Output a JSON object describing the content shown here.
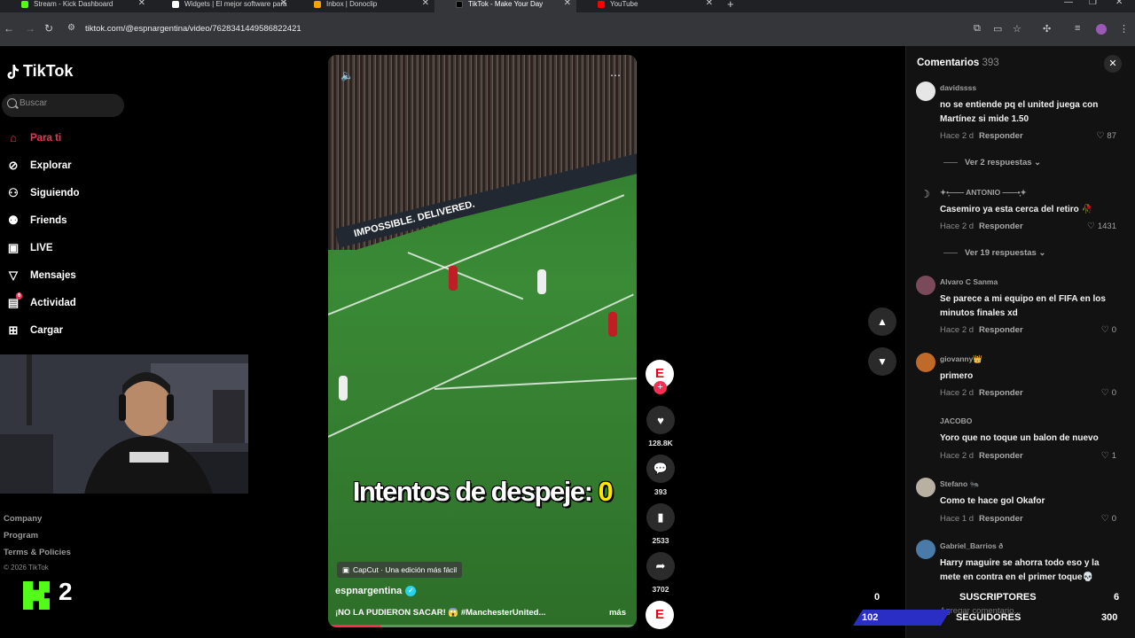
{
  "browser": {
    "tabs": [
      {
        "title": "Stream - Kick Dashboard",
        "color": "#53fc18",
        "active": false
      },
      {
        "title": "Widgets | El mejor software para",
        "color": "#ffffff",
        "active": false
      },
      {
        "title": "Inbox | Donoclip",
        "color": "#f4a300",
        "active": false
      },
      {
        "title": "TikTok - Make Your Day",
        "color": "#000000",
        "active": true
      },
      {
        "title": "YouTube",
        "color": "#ff0000",
        "active": false
      }
    ],
    "url": "tiktok.com/@espnargentina/video/7628341449586822421"
  },
  "sidebar": {
    "brand": "TikTok",
    "search_placeholder": "Buscar",
    "items": [
      {
        "label": "Para ti",
        "icon": "home-icon",
        "active": true
      },
      {
        "label": "Explorar",
        "icon": "compass-icon"
      },
      {
        "label": "Siguiendo",
        "icon": "following-icon"
      },
      {
        "label": "Friends",
        "icon": "friends-icon"
      },
      {
        "label": "LIVE",
        "icon": "live-icon"
      },
      {
        "label": "Mensajes",
        "icon": "messages-icon"
      },
      {
        "label": "Actividad",
        "icon": "activity-icon",
        "badge": "6"
      },
      {
        "label": "Cargar",
        "icon": "upload-icon"
      }
    ],
    "footer": [
      "Company",
      "Program",
      "Terms & Policies"
    ],
    "copyright": "© 2026 TikTok"
  },
  "kick_widget": {
    "count": "2"
  },
  "video": {
    "adboard": "IMPOSSIBLE. DELIVERED.",
    "overlay_prefix": "Intentos de despeje: ",
    "overlay_value": "0",
    "capcut": "CapCut · Una edición más fácil",
    "author": "espnargentina",
    "description": "¡NO LA PUDIERON SACAR! 😱 #ManchesterUnited...",
    "more": "más",
    "progress": 0.17
  },
  "actions": {
    "avatar_letter": "E",
    "likes": "128.8K",
    "comments": "393",
    "saves": "2533",
    "shares": "3702"
  },
  "comments": {
    "title": "Comentarios",
    "count": "393",
    "input_placeholder": "Agregar comentario...",
    "items": [
      {
        "user": "davidssss",
        "text": "no se entiende pq el united juega con Martínez si mide 1.50",
        "time": "Hace 2 d",
        "reply": "Responder",
        "likes": "87",
        "avatar": "#e6e6e6"
      },
      {
        "user": "✦•̩̩͙—— ANTONIO ——•̩̩͙✦",
        "text": "Casemiro ya esta cerca del retiro 🥀",
        "time": "Hace 2 d",
        "reply": "Responder",
        "likes": "1431",
        "avatar": "#121212"
      },
      {
        "user": "Alvaro C Sanma",
        "text": "Se parece a mi equipo en el FIFA en los minutos finales xd",
        "time": "Hace 2 d",
        "reply": "Responder",
        "likes": "0",
        "avatar": "#7a4a5a"
      },
      {
        "user": "giovanny👑",
        "text": "primero",
        "time": "Hace 2 d",
        "reply": "Responder",
        "likes": "0",
        "avatar": "#c06a2a"
      },
      {
        "user": "JACOBO",
        "text": "Yoro que no toque un balon de nuevo",
        "time": "Hace 2 d",
        "reply": "Responder",
        "likes": "1",
        "avatar": "#121212"
      },
      {
        "user": "Stefano 🐜",
        "text": "Como te hace gol Okafor",
        "time": "Hace 1 d",
        "reply": "Responder",
        "likes": "0",
        "avatar": "#b8b0a0"
      },
      {
        "user": "Gabriel_Barrios ð",
        "text": "Harry maguire se ahorra todo eso y la mete en contra en el primer toque💀",
        "time": "",
        "reply": "",
        "likes": "",
        "avatar": "#4a7aa8"
      }
    ],
    "view_replies": [
      "Ver 2 respuestas",
      "Ver 19 respuestas"
    ]
  },
  "stream_overlay": {
    "top_left": "0",
    "subs_label": "SUSCRIPTORES",
    "subs_value": "6",
    "followers_label": "SEGUIDORES",
    "followers_left": "102",
    "followers_value": "300"
  }
}
